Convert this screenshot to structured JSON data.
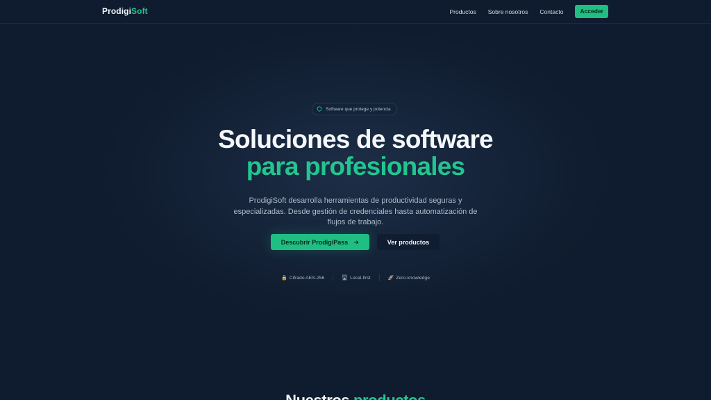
{
  "nav": {
    "logo_part1": "Prodigi",
    "logo_part2": "Soft",
    "links": [
      "Productos",
      "Sobre nosotros",
      "Contacto"
    ],
    "cta": "Acceder"
  },
  "hero": {
    "badge": "Software que protege y potencia",
    "badge_icon": "shield-icon",
    "title_line1": "Soluciones de software",
    "title_line2": "para profesionales",
    "lead": "ProdigiSoft desarrolla herramientas de productividad seguras y especializadas. Desde gestión de credenciales hasta automatización de flujos de trabajo.",
    "primary_button": "Descubrir ProdigiPass",
    "primary_button_icon": "arrow-right-icon",
    "secondary_button": "Ver productos",
    "features": [
      {
        "icon": "🔒",
        "icon_name": "lock-icon",
        "label": "Cifrado AES-256"
      },
      {
        "icon": "🖥️",
        "icon_name": "monitor-icon",
        "label": "Local-first"
      },
      {
        "icon": "🚀",
        "icon_name": "rocket-icon",
        "label": "Zero-knowledge"
      }
    ]
  },
  "section": {
    "title_part1": "Nuestros",
    "title_part2": "productos"
  },
  "colors": {
    "background": "#0f1b2e",
    "accent": "#22c58f",
    "button": "#1fbf84"
  }
}
